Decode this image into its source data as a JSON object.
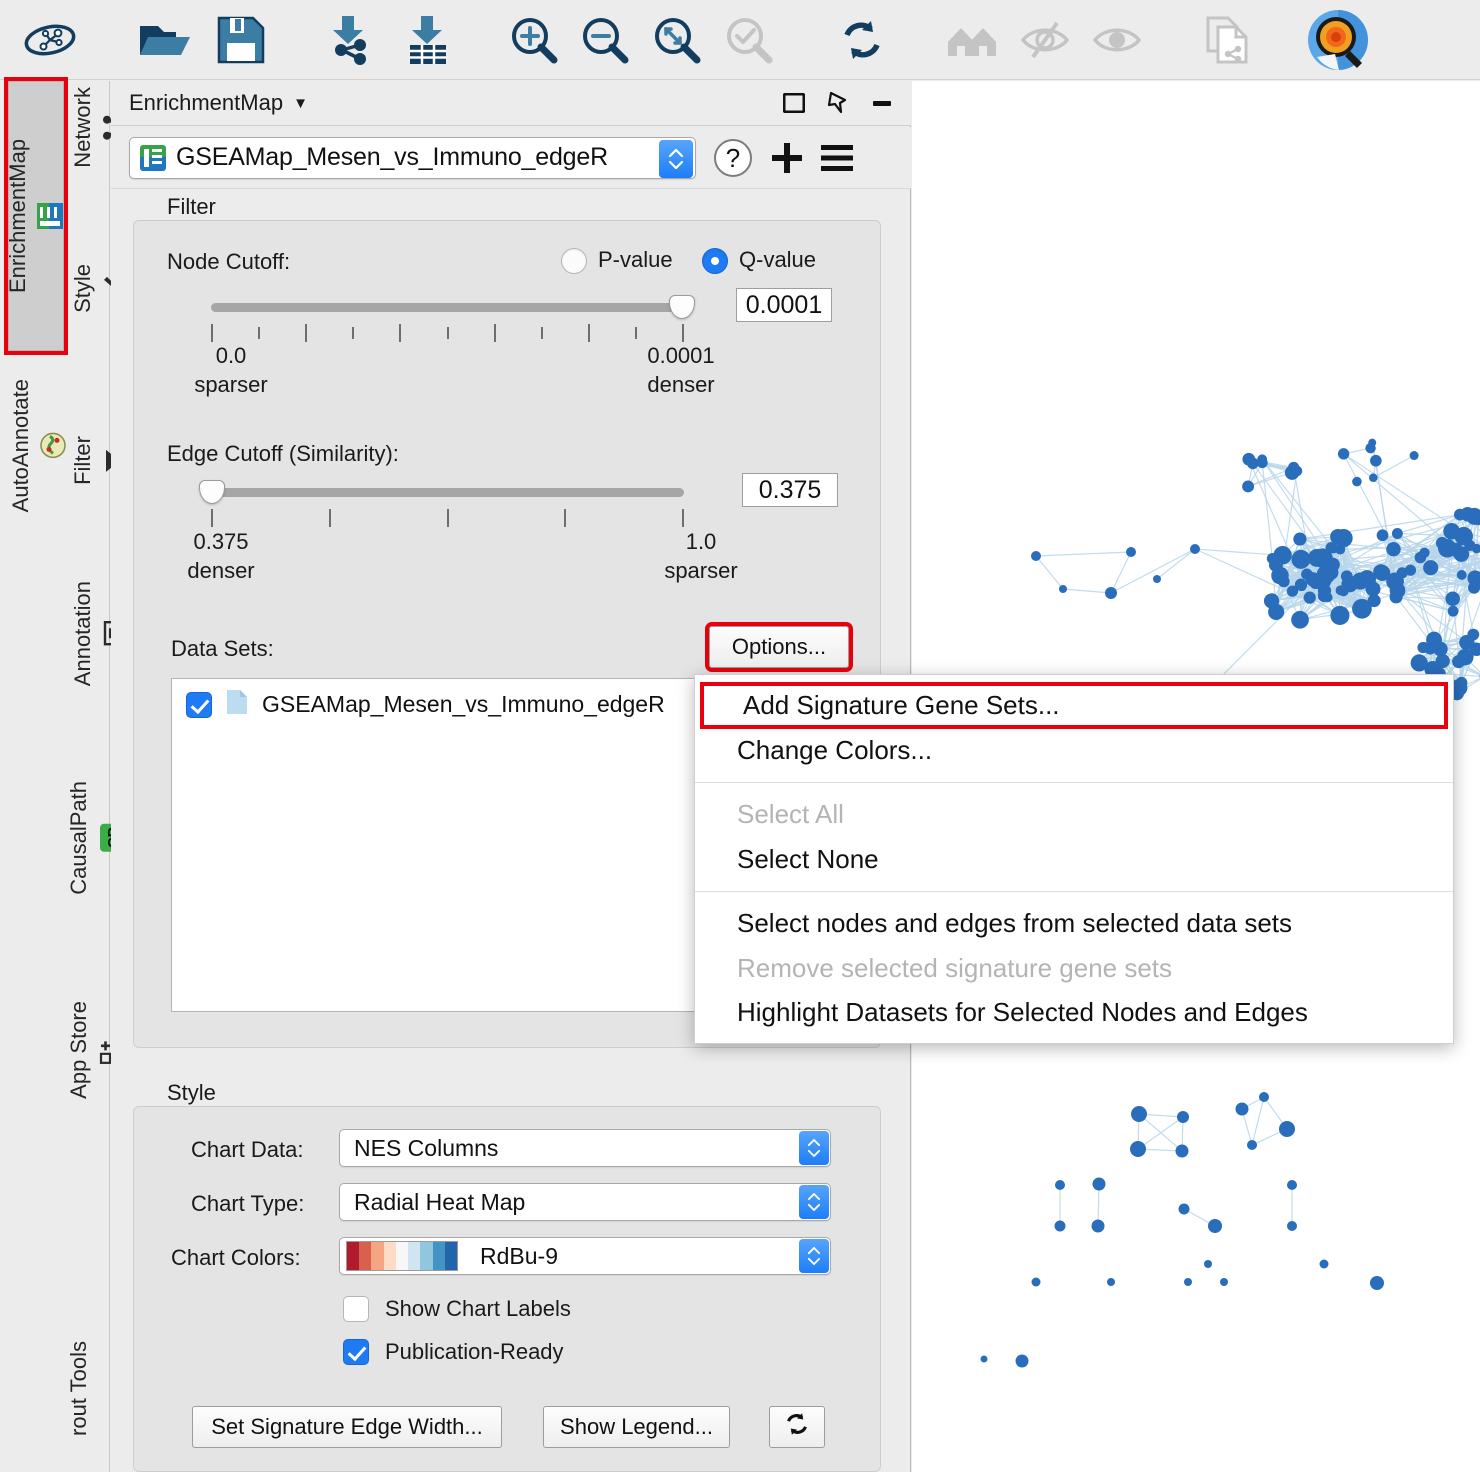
{
  "toolbar": {
    "icons": [
      {
        "name": "network-analyzer-icon",
        "label": "Network Analyzer"
      },
      {
        "name": "open-folder-icon",
        "label": "Open Session"
      },
      {
        "name": "save-icon",
        "label": "Save Session"
      },
      {
        "name": "import-network-icon",
        "label": "Import Network"
      },
      {
        "name": "import-table-icon",
        "label": "Import Table"
      },
      {
        "name": "zoom-in-icon",
        "label": "Zoom In"
      },
      {
        "name": "zoom-out-icon",
        "label": "Zoom Out"
      },
      {
        "name": "zoom-fit-icon",
        "label": "Fit Network"
      },
      {
        "name": "zoom-selected-icon",
        "label": "Fit Selected"
      },
      {
        "name": "refresh-icon",
        "label": "Refresh"
      },
      {
        "name": "home-icon",
        "label": "Home"
      },
      {
        "name": "hide-icon",
        "label": "Hide Selected"
      },
      {
        "name": "show-icon",
        "label": "Show All"
      },
      {
        "name": "copy-network-icon",
        "label": "Copy Network"
      },
      {
        "name": "enrichmentmap-app-icon",
        "label": "EnrichmentMap"
      }
    ]
  },
  "rail": {
    "tabs": [
      {
        "name": "enrichmentmap",
        "label": "EnrichmentMap",
        "icon": "em-badge-icon",
        "active": true,
        "highlighted": true
      },
      {
        "name": "network",
        "label": "Network",
        "icon": "network-icon",
        "active": false,
        "highlighted": false
      },
      {
        "name": "style",
        "label": "Style",
        "icon": "paintbrush-icon",
        "active": false,
        "highlighted": false
      },
      {
        "name": "autoannotate",
        "label": "AutoAnnotate",
        "icon": "autoannotate-icon",
        "active": false,
        "highlighted": false
      },
      {
        "name": "filter",
        "label": "Filter",
        "icon": "funnel-icon",
        "active": false,
        "highlighted": false
      },
      {
        "name": "annotation",
        "label": "Annotation",
        "icon": "text-box-icon",
        "active": false,
        "highlighted": false
      },
      {
        "name": "causalpath",
        "label": "CausalPath",
        "icon": "cp-badge-icon",
        "active": false,
        "highlighted": false
      },
      {
        "name": "appstore",
        "label": "App Store",
        "icon": "app-store-icon",
        "active": false,
        "highlighted": false
      },
      {
        "name": "layouttools",
        "label": "rout Tools",
        "icon": "none",
        "active": false,
        "highlighted": false
      }
    ]
  },
  "panel": {
    "title": "EnrichmentMap",
    "title_caret": "▼",
    "header_buttons": [
      {
        "name": "float-panel-button",
        "icon": "float-window-icon"
      },
      {
        "name": "pin-panel-button",
        "icon": "pin-icon"
      },
      {
        "name": "minimize-panel-button",
        "icon": "minimize-icon"
      }
    ],
    "network_selector": {
      "value": "GSEAMap_Mesen_vs_Immuno_edgeR",
      "badge": "em-badge-icon"
    },
    "help_button": "?",
    "add_button": "+",
    "menu_button": "hamburger-icon"
  },
  "filter": {
    "section_label": "Filter",
    "node_cutoff": {
      "label": "Node Cutoff:",
      "pvalue_label": "P-value",
      "qvalue_label": "Q-value",
      "selected": "Q-value",
      "value": "0.0001",
      "min_label": "0.0",
      "min_sub": "sparser",
      "max_label": "0.0001",
      "max_sub": "denser",
      "thumb_pct": 100
    },
    "edge_cutoff": {
      "label": "Edge Cutoff (Similarity):",
      "value": "0.375",
      "min_label": "0.375",
      "min_sub": "denser",
      "max_label": "1.0",
      "max_sub": "sparser",
      "thumb_pct": 0
    },
    "data_sets": {
      "label": "Data Sets:",
      "options_button": "Options...",
      "items": [
        {
          "name": "GSEAMap_Mesen_vs_Immuno_edgeR",
          "checked": true,
          "icon": "file-icon"
        }
      ]
    }
  },
  "context_menu": {
    "items": [
      {
        "label": "Add Signature Gene Sets...",
        "disabled": false,
        "highlighted": true
      },
      {
        "label": "Change Colors...",
        "disabled": false,
        "highlighted": false
      },
      {
        "separator": true
      },
      {
        "label": "Select All",
        "disabled": true,
        "highlighted": false
      },
      {
        "label": "Select None",
        "disabled": false,
        "highlighted": false
      },
      {
        "separator": true
      },
      {
        "label": "Select nodes and edges from selected data sets",
        "disabled": false,
        "highlighted": false
      },
      {
        "label": "Remove selected signature gene sets",
        "disabled": true,
        "highlighted": false
      },
      {
        "label": "Highlight Datasets for Selected Nodes and Edges",
        "disabled": false,
        "highlighted": false
      }
    ]
  },
  "style": {
    "section_label": "Style",
    "chart_data": {
      "label": "Chart Data:",
      "value": "NES Columns"
    },
    "chart_type": {
      "label": "Chart Type:",
      "value": "Radial Heat Map"
    },
    "chart_colors": {
      "label": "Chart Colors:",
      "value": "RdBu-9",
      "palette": [
        "#b01c2e",
        "#d9604f",
        "#f4a582",
        "#fddbc7",
        "#f7f7f7",
        "#d1e5f0",
        "#92c5de",
        "#4393c3",
        "#2166ac"
      ]
    },
    "show_chart_labels": {
      "label": "Show Chart Labels",
      "checked": false
    },
    "publication_ready": {
      "label": "Publication-Ready",
      "checked": true
    },
    "buttons": [
      {
        "name": "set-signature-edge-width-button",
        "label": "Set Signature Edge Width..."
      },
      {
        "name": "show-legend-button",
        "label": "Show Legend..."
      }
    ],
    "refresh_button": "refresh-icon"
  },
  "network_view": {
    "node_color": "#2a6ebb",
    "edge_color": "#b8d6ea",
    "background": "#ffffff"
  },
  "colors": {
    "accent_blue": "#1f7bf4",
    "highlight_red": "#e8000d",
    "panel_bg": "#ececec",
    "group_bg": "#e4e4e4",
    "toolbar_icon_dark": "#123d5e",
    "toolbar_icon_mid": "#3c7ea3",
    "toolbar_icon_disabled": "#c4c4c4"
  }
}
